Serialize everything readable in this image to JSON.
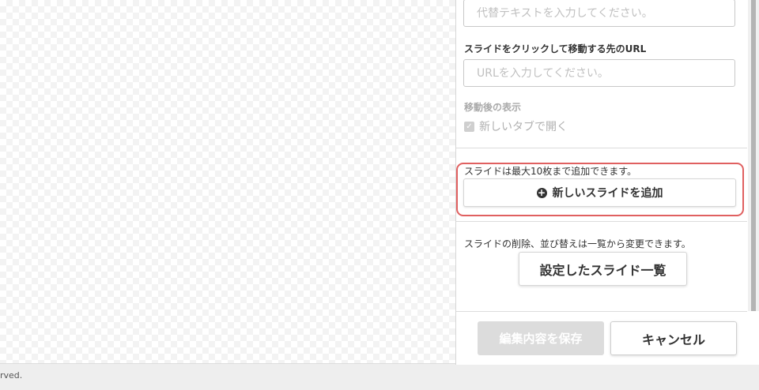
{
  "footer": {
    "copyright": "rved."
  },
  "form": {
    "alt_text_placeholder": "代替テキストを入力してください。",
    "url_label": "スライドをクリックして移動する先のURL",
    "url_placeholder": "URLを入力してください。",
    "display_label": "移動後の表示",
    "new_tab_label": "新しいタブで開く",
    "new_tab_checked": true
  },
  "add_section": {
    "max_note": "スライドは最大10枚まで追加できます。",
    "add_button_label": "新しいスライドを追加",
    "highlight_color": "#e06060"
  },
  "list_section": {
    "note": "スライドの削除、並び替えは一覧から変更できます。",
    "list_button_label": "設定したスライド一覧"
  },
  "actions": {
    "save_label": "編集内容を保存",
    "cancel_label": "キャンセル"
  },
  "icons": {
    "plus": "plus-circle-icon",
    "check": "check-icon"
  }
}
